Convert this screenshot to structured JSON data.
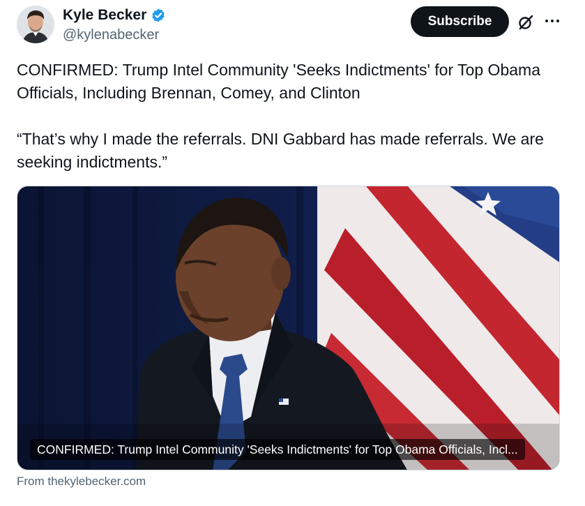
{
  "author": {
    "display_name": "Kyle Becker",
    "handle": "@kylenabecker",
    "verified": true
  },
  "header": {
    "subscribe_label": "Subscribe",
    "grok_icon": "grok-icon",
    "more_icon": "more-icon"
  },
  "post": {
    "paragraph_1": "CONFIRMED: Trump Intel Community 'Seeks Indictments' for Top Obama Officials, Including Brennan, Comey, and Clinton",
    "paragraph_2": "“That’s why I made the referrals. DNI Gabbard has made referrals. We are seeking indictments.”"
  },
  "card": {
    "caption": "CONFIRMED: Trump Intel Community 'Seeks Indictments' for Top Obama Officials, Incl...",
    "source": "From thekylebecker.com"
  },
  "colors": {
    "text": "#0f1419",
    "secondary": "#536471",
    "verified_blue": "#1d9bf0",
    "button_bg": "#0f1419"
  }
}
